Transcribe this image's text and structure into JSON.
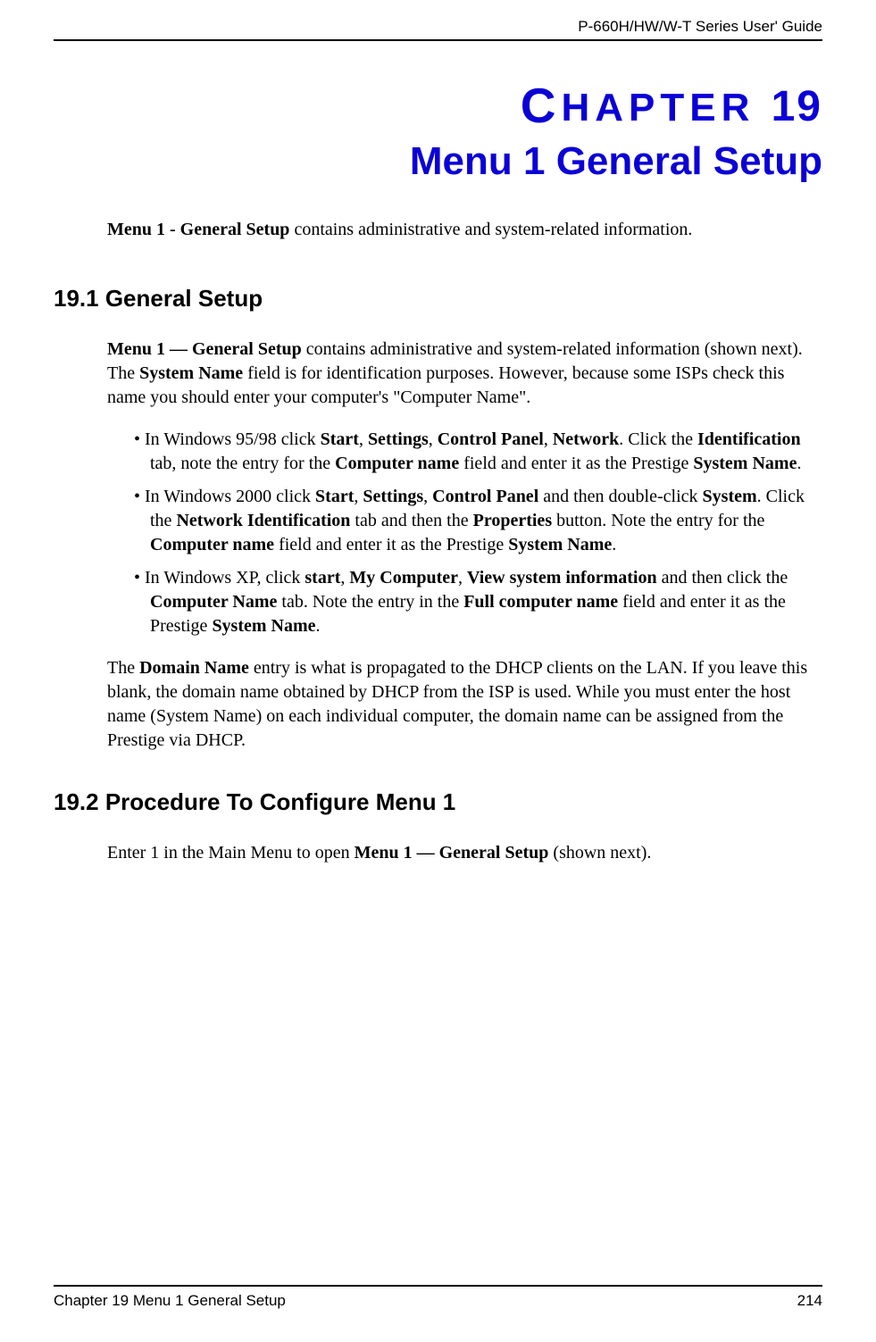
{
  "header": {
    "guide_title": "P-660H/HW/W-T Series User' Guide"
  },
  "chapter": {
    "label_word": "HAPTER",
    "label_letter": "C",
    "number": "19",
    "title": "Menu 1 General Setup"
  },
  "intro": {
    "bold_lead": "Menu 1 - General Setup",
    "rest": " contains administrative and system-related information."
  },
  "section1": {
    "heading": "19.1  General Setup",
    "p1_bold": "Menu 1 — General Setup",
    "p1_rest_a": " contains administrative and system-related information (shown next). The ",
    "p1_bold2": "System Name",
    "p1_rest_b": " field is for identification purposes. However, because some ISPs check this name you should enter your computer's  \"Computer Name\".",
    "bullets": [
      {
        "pre": "In Windows 95/98 click ",
        "b1": "Start",
        "c1": ", ",
        "b2": "Settings",
        "c2": ", ",
        "b3": "Control Panel",
        "c3": ", ",
        "b4": "Network",
        "c4": ". Click the ",
        "b5": "Identification",
        "c5": " tab, note the entry for the ",
        "b6": "Computer name",
        "c6": " field and enter it as the Prestige ",
        "b7": "System Name",
        "c7": "."
      },
      {
        "pre": "In Windows 2000 click ",
        "b1": "Start",
        "c1": ", ",
        "b2": "Settings",
        "c2": ", ",
        "b3": "Control Panel",
        "c3": " and then double-click ",
        "b4": "System",
        "c4": ". Click the ",
        "b5": "Network Identification",
        "c5": " tab and then the ",
        "b6": "Properties",
        "c6": " button. Note the entry for the ",
        "b7": "Computer name",
        "c7": " field and enter it as the Prestige ",
        "b8": "System Name",
        "c8": "."
      },
      {
        "pre": "In Windows XP, click ",
        "b1": "start",
        "c1": ", ",
        "b2": "My Computer",
        "c2": ", ",
        "b3": "View system information",
        "c3": " and then click the ",
        "b4": "Computer Name",
        "c4": " tab. Note the entry in the ",
        "b5": "Full computer name",
        "c5": " field and enter it as the Prestige ",
        "b6": "System Name",
        "c6": "."
      }
    ],
    "p2_a": "The ",
    "p2_b1": "Domain Name",
    "p2_b": " entry is what is propagated to the DHCP clients on the LAN. If you leave this blank, the domain name obtained by DHCP from the ISP is used. While you must enter the host name (System Name) on each individual computer, the domain name can be assigned from the Prestige via DHCP."
  },
  "section2": {
    "heading": "19.2  Procedure To Configure Menu 1",
    "p1_a": "Enter 1 in the Main Menu to open ",
    "p1_b": "Menu 1 — General Setup",
    "p1_c": " (shown next)."
  },
  "footer": {
    "left": "Chapter 19 Menu 1 General Setup",
    "right": "214"
  }
}
